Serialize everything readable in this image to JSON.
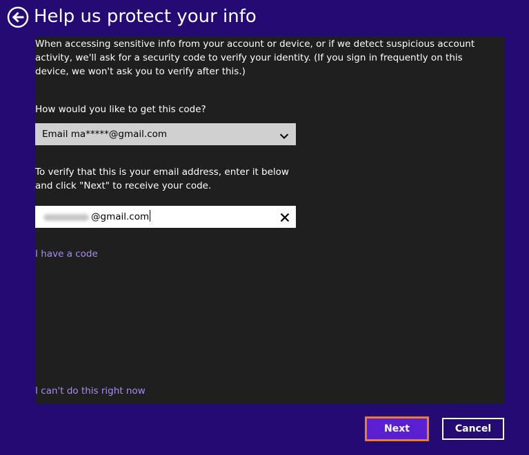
{
  "header": {
    "title": "Help us protect your info",
    "back_icon": "back-arrow-icon"
  },
  "form": {
    "intro": "When accessing sensitive info from your account or device, or if we detect suspicious account activity, we'll ask for a security code to verify your identity. (If you sign in frequently on this device, we won't ask you to verify after this.)",
    "question": "How would you like to get this code?",
    "method_select": {
      "value": "Email ma*****@gmail.com",
      "icon": "chevron-down-icon"
    },
    "verify_text": "To verify that this is your email address, enter it below and click \"Next\" to receive your code.",
    "email_input": {
      "value": "@gmail.com",
      "clear_icon": "close-icon"
    },
    "have_code_link": "I have a code",
    "cant_do_link": "I can't do this right now"
  },
  "footer": {
    "next_label": "Next",
    "cancel_label": "Cancel"
  },
  "colors": {
    "background": "#240a73",
    "panel": "#1f1f1f",
    "link": "#a88cf0",
    "next_button": "#5a1fd1",
    "focus_border": "#f07d22"
  }
}
